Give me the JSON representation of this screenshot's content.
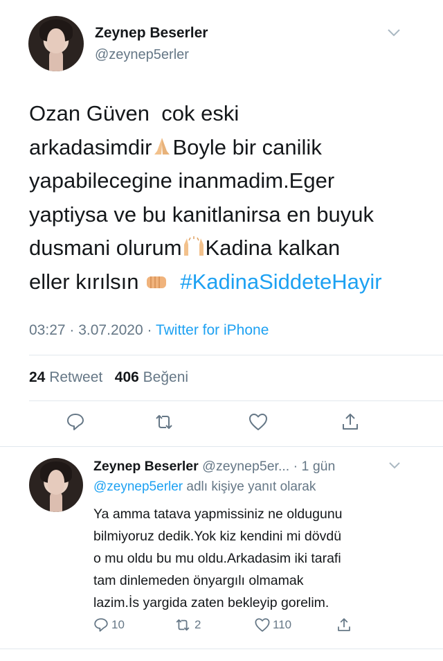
{
  "main_tweet": {
    "author_name": "Zeynep Beserler",
    "handle": "@zeynep5erler",
    "text_1": "Ozan Güven  cok eski\narkadasimdir",
    "text_2": "Boyle bir canilik\nyapabilecegine inanmadim.Eger\nyaptiysa ve bu kanitlanirsa en buyuk\ndusmani olurum",
    "text_3": "Kadina kalkan\neller kırılsın ",
    "hashtag": "#KadinaSiddeteHayir",
    "time": "03:27",
    "date": "3.07.2020",
    "separator": " · ",
    "source": "Twitter for iPhone",
    "retweet_count": "24",
    "retweet_label": "Retweet",
    "like_count": "406",
    "like_label": "Beğeni"
  },
  "reply_tweet": {
    "author_name": "Zeynep Beserler",
    "handle_truncated": "@zeynep5er...",
    "age": "· 1 gün",
    "replying_to_handle": "@zeynep5erler",
    "replying_to_suffix": "adlı kişiye yanıt olarak",
    "text": "Ya amma tatava yapmissiniz ne oldugunu\nbilmiyoruz dedik.Yok kiz kendini mi dövdü\no mu oldu bu mu oldu.Arkadasim iki tarafi\ntam dinlemeden önyargılı olmamak\nlazim.İs yargida zaten bekleyip gorelim.",
    "reply_count": "10",
    "retweet_count": "2",
    "like_count": "110"
  },
  "icons": {
    "reply": "reply-icon",
    "retweet": "retweet-icon",
    "like": "heart-icon",
    "share": "share-icon",
    "menu": "chevron-down-icon"
  },
  "colors": {
    "accent": "#1da1f2",
    "secondary_text": "#657786",
    "primary_text": "#14171a"
  }
}
